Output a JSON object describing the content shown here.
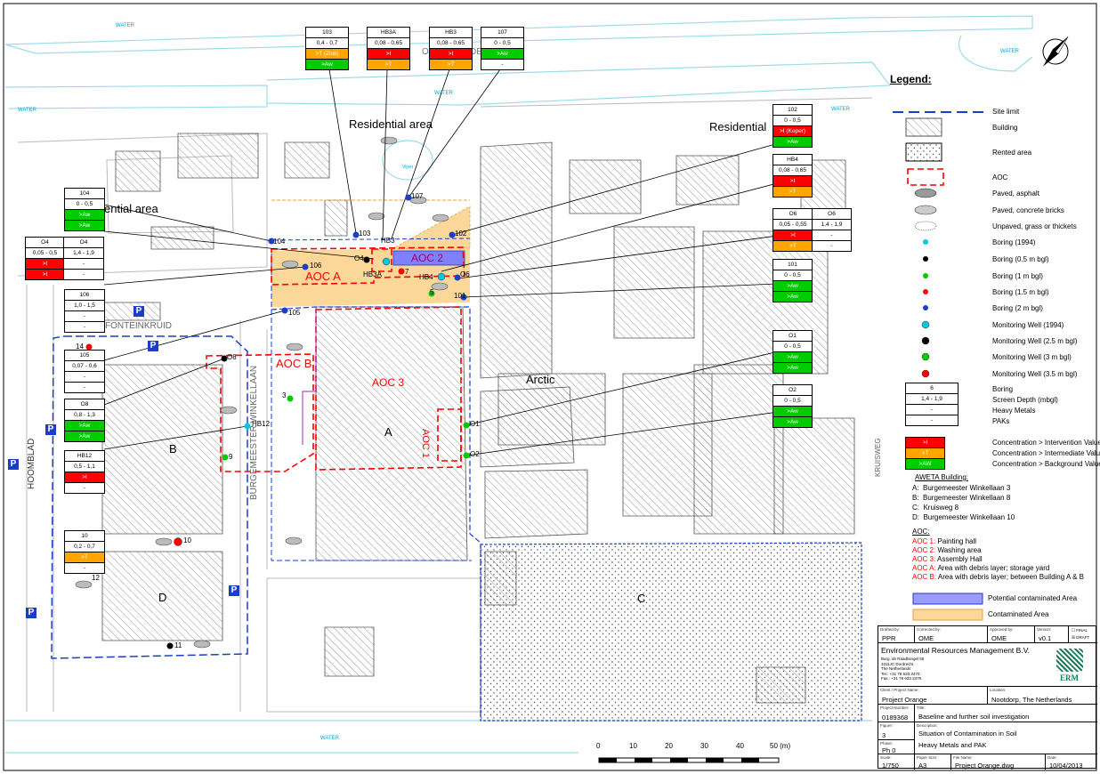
{
  "labels": {
    "water": "WATER",
    "residential": "Residential area",
    "residential_right": "Residential",
    "residential_left": "ential area",
    "ood": "OO",
    "ood2": "DE",
    "aocA": "AOC A",
    "aocB": "AOC B",
    "aoc2": "AOC 2",
    "aoc3": "AOC 3",
    "aoc1": "AOC 1",
    "arctic": "Arctic",
    "bldA": "A",
    "bldB": "B",
    "bldC": "C",
    "bldD": "D",
    "fonteinkruid": "FONTEINKRUID",
    "burgemeester": "BURGEMEESTER WINKELLAAN",
    "hoomblad": "HOOMBLAD",
    "kruisweg": "KRUISWEG",
    "vijver": "Vijver",
    "p": "P"
  },
  "points": {
    "p103": "103",
    "p104": "104",
    "p102": "102",
    "p107": "107",
    "p106": "106",
    "p105": "105",
    "p101": "101",
    "pO4": "O4",
    "pHB3A": "HB3A",
    "pHB3": "HB3",
    "p7": "7",
    "pHB4": "HB4",
    "p5": "5",
    "pO6": "O6",
    "pO8": "O8",
    "p14": "14",
    "p3": "3",
    "pHB12": "HB12",
    "p9": "9",
    "pO1": "O1",
    "pO2": "O2",
    "p10": "10",
    "p12": "12",
    "p11": "11"
  },
  "samples": {
    "t103": [
      "103",
      "0,4 - 0,7",
      ">T (Zink)",
      ">Aw"
    ],
    "tHB3A": [
      "HB3A",
      "0,08 - 0,65",
      ">I",
      ">T"
    ],
    "tHB3": [
      "HB3",
      "0,08 - 0,65",
      ">I",
      ">T"
    ],
    "t107": [
      "107",
      "0 - 0,5",
      ">Aw",
      "-"
    ],
    "t104": [
      "104",
      "0 - 0,5",
      ">Aw",
      ">Aw"
    ],
    "tO4a": [
      "O4",
      "0,05 - 0,5",
      ">I",
      ">I"
    ],
    "tO4b": [
      "O4",
      "1,4 - 1,9",
      "-",
      "-"
    ],
    "t106": [
      "106",
      "1,0 - 1,5",
      "-",
      "-"
    ],
    "t105": [
      "105",
      "0,07 - 0,6",
      "-",
      "-"
    ],
    "tO8": [
      "O8",
      "0,8 - 1,3",
      ">Aw",
      ">Aw"
    ],
    "tHB12": [
      "HB12",
      "0,5 - 1,1",
      ">I",
      "-"
    ],
    "t10": [
      "10",
      "0,2 - 0,7",
      ">T",
      "-"
    ],
    "t102": [
      "102",
      "0 - 0,5",
      ">I (Koper)",
      ">Aw"
    ],
    "tHB4": [
      "HB4",
      "0,08 - 0,65",
      ">I",
      ">T"
    ],
    "tO6a": [
      "O6",
      "0,05 - 0,55",
      ">I",
      ">T"
    ],
    "tO6b": [
      "O6",
      "1,4 - 1,9",
      "-",
      "-"
    ],
    "t101": [
      "101",
      "0 - 0,5",
      ">Aw",
      ">Aw"
    ],
    "tO1": [
      "O1",
      "0 - 0,5",
      ">Aw",
      ">Aw"
    ],
    "tO2": [
      "O2",
      "0 - 0,5",
      ">Aw",
      ">Aw"
    ]
  },
  "legend": {
    "title": "Legend:",
    "site_limit": "Site limit",
    "building": "Building",
    "rented": "Rented area",
    "aoc": "AOC",
    "asphalt": "Paved, asphalt",
    "concrete": "Paved, concrete bricks",
    "unpaved": "Unpaved, grass or thickets",
    "b1994": "Boring (1994)",
    "b05": "Boring (0.5 m bgl)",
    "b1": "Boring (1 m bgl)",
    "b15": "Boring (1.5 m bgl)",
    "b2": "Boring (2 m bgl)",
    "mw1994": "Monitoring Well (1994)",
    "mw25": "Monitoring Well (2.5 m bgl)",
    "mw3": "Monitoring Well (3 m bgl)",
    "mw35": "Monitoring Well (3.5 m bgl)",
    "key": [
      "6",
      "1,4 - 1,9",
      "-",
      "-"
    ],
    "key_labels": [
      "Boring",
      "Screen Depth (mbgl)",
      "Heavy Metals",
      "PAKs"
    ],
    "conc": [
      ">I",
      ">T",
      ">AW"
    ],
    "conc_labels": [
      "Concentration > Intervention Value",
      "Concentration > Intermediate Value",
      "Concentration > Background Value"
    ],
    "aweta_title": "AWETA Building:",
    "aweta": [
      [
        "A:",
        "Burgemeester Winkellaan 3"
      ],
      [
        "B:",
        "Burgemeester Winkellaan 8"
      ],
      [
        "C:",
        "Kruisweg 8"
      ],
      [
        "D:",
        "Burgemeester Winkellaan 10"
      ]
    ],
    "aoc_title": "AOC:",
    "aocs": [
      [
        "AOC 1:",
        " Painting hall"
      ],
      [
        "AOC 2:",
        " Washing area"
      ],
      [
        "AOC 3:",
        " Assembly Hall"
      ],
      [
        "AOC A:",
        " Area with debris layer; storage yard"
      ],
      [
        "AOC B:",
        " Area with debris layer; between Building A & B"
      ]
    ],
    "potential": "Potential contaminated Area",
    "contaminated": "Contaminated Area"
  },
  "colors": {
    "blue": "#1a3ec8",
    "red": "#ff0000",
    "green": "#00cc00",
    "orange": "#ffa500",
    "cyan": "#00c8e0",
    "purple": "#8080ff",
    "contam": "#fbd79a"
  },
  "titleblock": {
    "drafted_cap": "Drafted by:",
    "drafted": "PPR",
    "corrected_cap": "Corrected by:",
    "corrected": "OME",
    "approved_cap": "Approved by:",
    "approved": "OME",
    "version_cap": "Version:",
    "version": "v0.1",
    "final": "FINAL",
    "draft": "DRAFT",
    "company": "Environmental Resources Management B.V.",
    "address": [
      "Burg. de Raadtsingel 55",
      "3311JC Dordrecht",
      "The Netherlands",
      "Tel.: +31 78 633 3470",
      "Fax.: +31 78 633 3479"
    ],
    "logo": "ERM",
    "client_cap": "Client / Project Name:",
    "client": "Project Orange",
    "location_cap": "Location:",
    "location": "Nootdorp, The Netherlands",
    "projnum_cap": "Project Number:",
    "projnum": "0189368",
    "title_cap": "Title:",
    "title": "Baseline and further soil investigation",
    "figure_cap": "Figure:",
    "figure": "3",
    "desc_cap": "Description:",
    "desc1": "Situation of Contamination in Soil",
    "desc2": "Heavy Metals and PAK",
    "phase_cap": "Phase:",
    "phase": "Ph 0",
    "scale_cap": "Scale:",
    "scale": "1/750",
    "paper_cap": "Paper Size:",
    "paper": "A3",
    "file_cap": "File Name:",
    "file": "Project Orange.dwg",
    "date_cap": "Date:",
    "date": "10/04/2013"
  },
  "scalebar": {
    "ticks": [
      "0",
      "10",
      "20",
      "30",
      "40",
      "50 (m)"
    ]
  }
}
